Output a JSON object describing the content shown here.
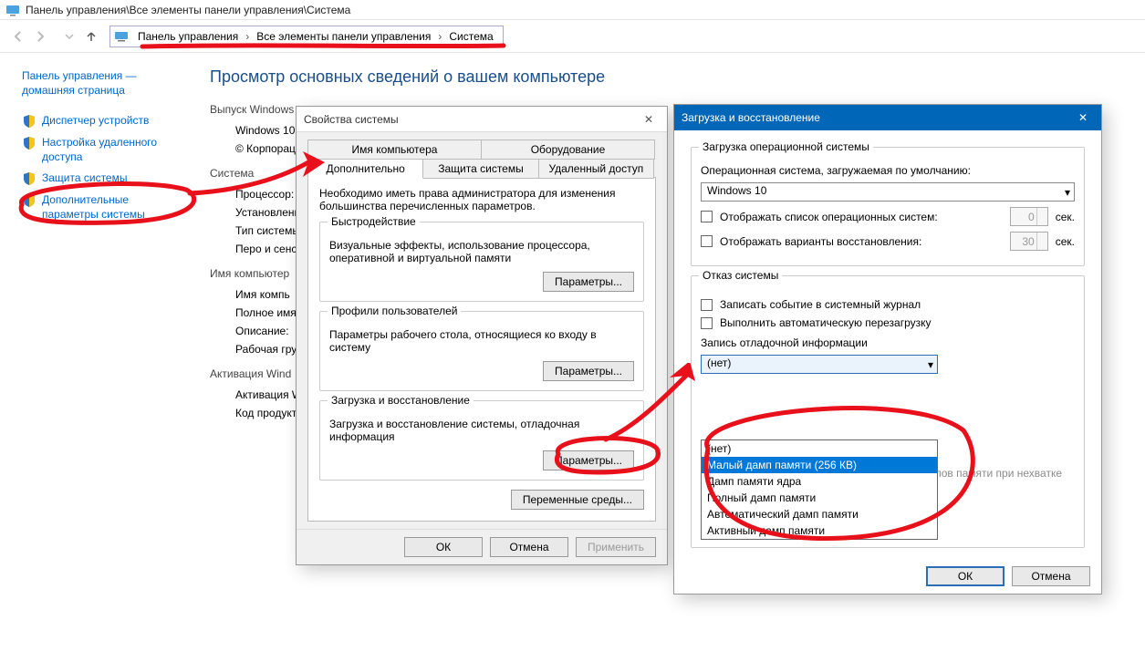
{
  "window": {
    "title_path": "Панель управления\\Все элементы панели управления\\Система"
  },
  "breadcrumb": {
    "a": "Панель управления",
    "b": "Все элементы панели управления",
    "c": "Система"
  },
  "sidebar": {
    "home": "Панель управления — домашняя страница",
    "links": [
      "Диспетчер устройств",
      "Настройка удаленного доступа",
      "Защита системы",
      "Дополнительные параметры системы"
    ]
  },
  "content": {
    "heading": "Просмотр основных сведений о вашем компьютере",
    "group_edition": "Выпуск Windows",
    "edition_name": "Windows 10",
    "edition_copy": "© Корпорац",
    "group_system": "Система",
    "sys_cpu": "Процессор:",
    "sys_ram": "Установленн (ОЗУ):",
    "sys_type": "Тип системы",
    "sys_pen": "Перо и сенс",
    "group_name": "Имя компьютер",
    "name_comp": "Имя компь",
    "name_full": "Полное имя",
    "name_desc": "Описание:",
    "name_wg": "Рабочая гру",
    "group_act": "Активация Wind",
    "act_state": "Активация W",
    "act_key": "Код продукт"
  },
  "dlg1": {
    "title": "Свойства системы",
    "tabs": {
      "name": "Имя компьютера",
      "hw": "Оборудование",
      "adv": "Дополнительно",
      "prot": "Защита системы",
      "remote": "Удаленный доступ"
    },
    "note": "Необходимо иметь права администратора для изменения большинства перечисленных параметров.",
    "perf_legend": "Быстродействие",
    "perf_text": "Визуальные эффекты, использование процессора, оперативной и виртуальной памяти",
    "profiles_legend": "Профили пользователей",
    "profiles_text": "Параметры рабочего стола, относящиеся ко входу в систему",
    "startup_legend": "Загрузка и восстановление",
    "startup_text": "Загрузка и восстановление системы, отладочная информация",
    "btn_params": "Параметры...",
    "btn_env": "Переменные среды...",
    "btn_ok": "ОК",
    "btn_cancel": "Отмена",
    "btn_apply": "Применить"
  },
  "dlg2": {
    "title": "Загрузка и восстановление",
    "grp_boot": "Загрузка операционной системы",
    "lbl_default_os": "Операционная система, загружаемая по умолчанию:",
    "os_value": "Windows 10",
    "cb_oslist": "Отображать список операционных систем:",
    "cb_recovery": "Отображать варианты восстановления:",
    "val_oslist_sec": "0",
    "val_recovery_sec": "30",
    "unit_sec": "сек.",
    "grp_fail": "Отказ системы",
    "cb_log": "Записать событие в системный журнал",
    "cb_reboot": "Выполнить автоматическую перезагрузку",
    "lbl_dump": "Запись отладочной информации",
    "dump_selected": "(нет)",
    "dump_options": [
      "(нет)",
      "Малый дамп памяти (256 КВ)",
      "Дамп памяти ядра",
      "Полный дамп памяти",
      "Автоматический дамп памяти",
      "Активный дамп памяти"
    ],
    "footer_hint": "Отключить автоматическое удаление дампов памяти при нехватке места на диске",
    "btn_ok": "ОК",
    "btn_cancel": "Отмена"
  }
}
